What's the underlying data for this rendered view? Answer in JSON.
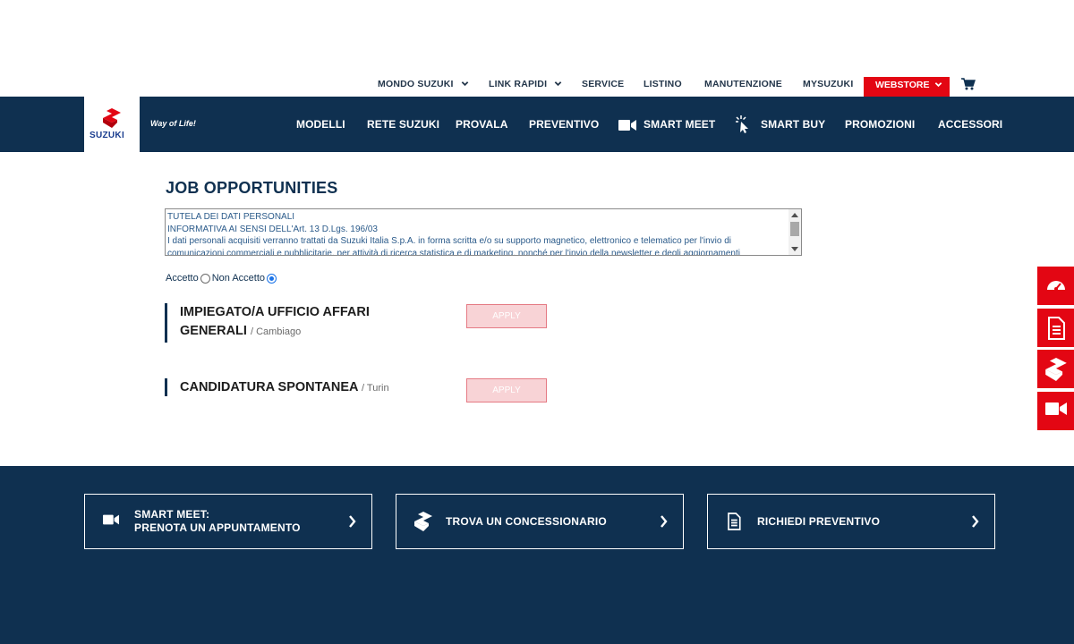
{
  "topbar": {
    "items": [
      {
        "label": "MONDO SUZUKI",
        "dropdown": true
      },
      {
        "label": "LINK RAPIDI",
        "dropdown": true
      },
      {
        "label": "SERVICE",
        "dropdown": false
      },
      {
        "label": "LISTINO",
        "dropdown": false
      },
      {
        "label": "MANUTENZIONE",
        "dropdown": false
      },
      {
        "label": "MYSUZUKI",
        "dropdown": false
      }
    ],
    "webstore_label": "WEBSTORE",
    "cart_icon": "cart-icon"
  },
  "brand": {
    "logo_text": "SUZUKI",
    "tagline": "Way of Life!",
    "color": "#e30613"
  },
  "nav": {
    "items": [
      {
        "label": "MODELLI"
      },
      {
        "label": "RETE SUZUKI"
      },
      {
        "label": "PROVALA"
      },
      {
        "label": "PREVENTIVO"
      },
      {
        "label": "SMART MEET",
        "icon": "video-camera-icon"
      },
      {
        "label": "SMART BUY",
        "icon": "cursor-click-icon"
      },
      {
        "label": "PROMOZIONI"
      },
      {
        "label": "ACCESSORI"
      }
    ],
    "background": "#0f3050"
  },
  "main": {
    "title": "JOB OPPORTUNITIES",
    "privacy_lines": [
      "TUTELA DEI DATI PERSONALI",
      "INFORMATIVA AI SENSI DELL'Art. 13 D.Lgs. 196/03",
      "I dati personali acquisiti verranno trattati da Suzuki Italia S.p.A. in forma scritta e/o su supporto magnetico, elettronico e telematico per l'invio di",
      "comunicazioni commerciali e pubblicitarie, per attività di ricerca statistica e di marketing, nonché per l'invio della newsletter e degli aggiornamenti"
    ],
    "consent": {
      "accept_label": "Accetto",
      "reject_label": "Non Accetto",
      "selected": "Non Accetto"
    },
    "jobs": [
      {
        "title": "IMPIEGATO/A UFFICIO AFFARI GENERALI",
        "title_line1": "IMPIEGATO/A UFFICIO AFFARI",
        "title_line2": "GENERALI",
        "location": "/ Cambiago",
        "apply_label": "APPLY"
      },
      {
        "title": "CANDIDATURA SPONTANEA",
        "location": "/ Turin",
        "apply_label": "APPLY"
      }
    ]
  },
  "side_tabs": [
    {
      "icon": "speedometer-icon"
    },
    {
      "icon": "document-icon"
    },
    {
      "icon": "suzuki-logo-icon"
    },
    {
      "icon": "video-camera-icon"
    }
  ],
  "footer": {
    "boxes": [
      {
        "line1": "SMART MEET:",
        "line2": "PRENOTA UN APPUNTAMENTO",
        "icon": "video-camera-icon"
      },
      {
        "line1": "TROVA UN CONCESSIONARIO",
        "icon": "suzuki-logo-icon"
      },
      {
        "line1": "RICHIEDI PREVENTIVO",
        "icon": "document-icon"
      }
    ]
  }
}
